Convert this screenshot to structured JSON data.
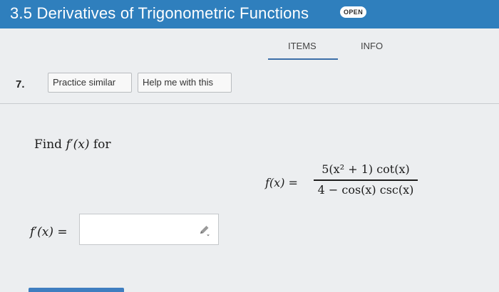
{
  "header": {
    "title": "3.5 Derivatives of Trigonometric Functions",
    "badge": "OPEN"
  },
  "tabs": [
    {
      "label": "ITEMS",
      "active": true
    },
    {
      "label": "INFO",
      "active": false
    }
  ],
  "question": {
    "number": "7.",
    "buttons": {
      "practice_similar": "Practice similar",
      "help": "Help me with this"
    },
    "prompt": {
      "find": "Find ",
      "derivative": "f′(x)",
      "for": " for"
    },
    "function": {
      "lhs": "f(x) =",
      "numerator": "5(x² + 1) cot(x)",
      "denominator": "4 − cos(x) csc(x)"
    },
    "answer": {
      "label": "f′(x) =",
      "value": ""
    }
  },
  "icons": {
    "edit": "pencil-icon"
  },
  "colors": {
    "header_bg": "#2f7fbd",
    "tab_underline": "#3c6fa8",
    "page_bg": "#eceef0"
  }
}
